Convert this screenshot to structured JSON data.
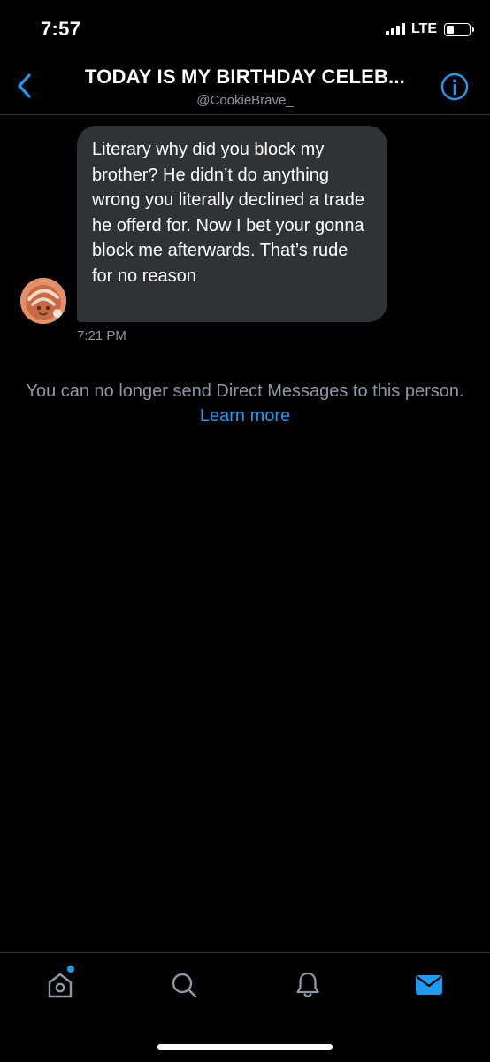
{
  "status_bar": {
    "time": "7:57",
    "network": "LTE"
  },
  "header": {
    "title": "TODAY IS MY BIRTHDAY CELEB...",
    "handle": "@CookieBrave_",
    "back_icon": "chevron-left-icon",
    "info_icon": "info-icon"
  },
  "conversation": {
    "messages": [
      {
        "text": "Literary why did you block my brother? He didn’t do anything wrong you literally declined a trade he offerd for. Now I bet your gonna block me afterwards. That’s rude for no reason",
        "time": "7:21 PM",
        "direction": "incoming"
      }
    ],
    "notice": {
      "text": "You can no longer send Direct Messages to this person.",
      "link": "Learn more"
    }
  },
  "bottom_nav": {
    "items": [
      {
        "icon": "home-icon",
        "active": false,
        "badge": true
      },
      {
        "icon": "search-icon",
        "active": false
      },
      {
        "icon": "bell-icon",
        "active": false
      },
      {
        "icon": "mail-icon",
        "active": true
      }
    ]
  },
  "colors": {
    "background": "#000000",
    "bubble": "#2f3336",
    "accent": "#1d9bf0",
    "muted_text": "#8b98a5",
    "divider": "#2f3336"
  }
}
